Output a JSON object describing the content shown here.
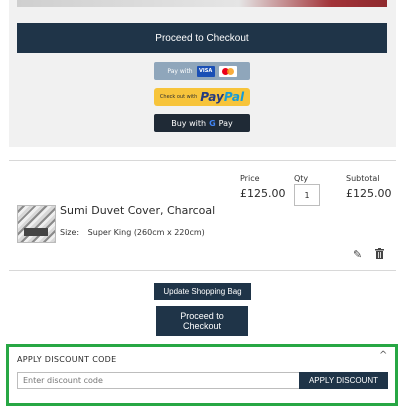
{
  "top": {
    "checkout_label": "Proceed to Checkout",
    "pay_with_label": "Pay with",
    "visa_label": "VISA",
    "paypal_small": "Check out with",
    "paypal_brand_a": "Pay",
    "paypal_brand_b": "Pal",
    "gpay_prefix": "Buy with",
    "gpay_g": "G",
    "gpay_suffix": "Pay"
  },
  "table": {
    "headers": {
      "price": "Price",
      "qty": "Qty",
      "subtotal": "Subtotal"
    },
    "item": {
      "name": "Sumi Duvet Cover, Charcoal",
      "size_label": "Size:",
      "size_value": "Super King (260cm x 220cm)",
      "price": "£125.00",
      "qty": "1",
      "subtotal": "£125.00"
    }
  },
  "actions": {
    "update_label": "Update Shopping Bag",
    "checkout_label": "Proceed to Checkout"
  },
  "discount": {
    "title": "APPLY DISCOUNT CODE",
    "placeholder": "Enter discount code",
    "apply_label": "APPLY DISCOUNT"
  },
  "colors": {
    "primary": "#1f3448",
    "highlight_border": "#27a744",
    "paypal_yellow": "#f7c43b"
  }
}
